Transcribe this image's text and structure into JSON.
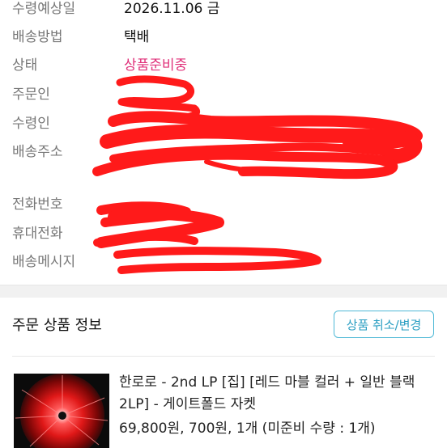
{
  "order_info": {
    "rows": [
      {
        "label": "수령예상일",
        "value": "2026.11.06 금"
      },
      {
        "label": "배송방법",
        "value": "택배"
      },
      {
        "label": "상태",
        "value": "상품준비중"
      },
      {
        "label": "주문인",
        "value": ""
      },
      {
        "label": "수령인",
        "value": ""
      },
      {
        "label": "배송주소",
        "value": ""
      },
      {
        "label": "전화번호",
        "value": ""
      },
      {
        "label": "휴대전화",
        "value": ""
      },
      {
        "label": "배송메시지",
        "value": ""
      }
    ],
    "status_color": "#e0317a",
    "redaction_color": "#ff1a1a"
  },
  "order_products": {
    "title": "주문 상품 정보",
    "cancel_label": "상품 취소/변경",
    "items": [
      {
        "name": "한로로 - 2nd LP [집] [레드 마블 컬러 + 일반 블랙 2LP] - 게이트폴드 자켓",
        "price_line": "69,800원, 700원, 1개 (미준비 수량 : 1개)",
        "thumbnail_icon": "album-cover-red-burst"
      }
    ]
  }
}
